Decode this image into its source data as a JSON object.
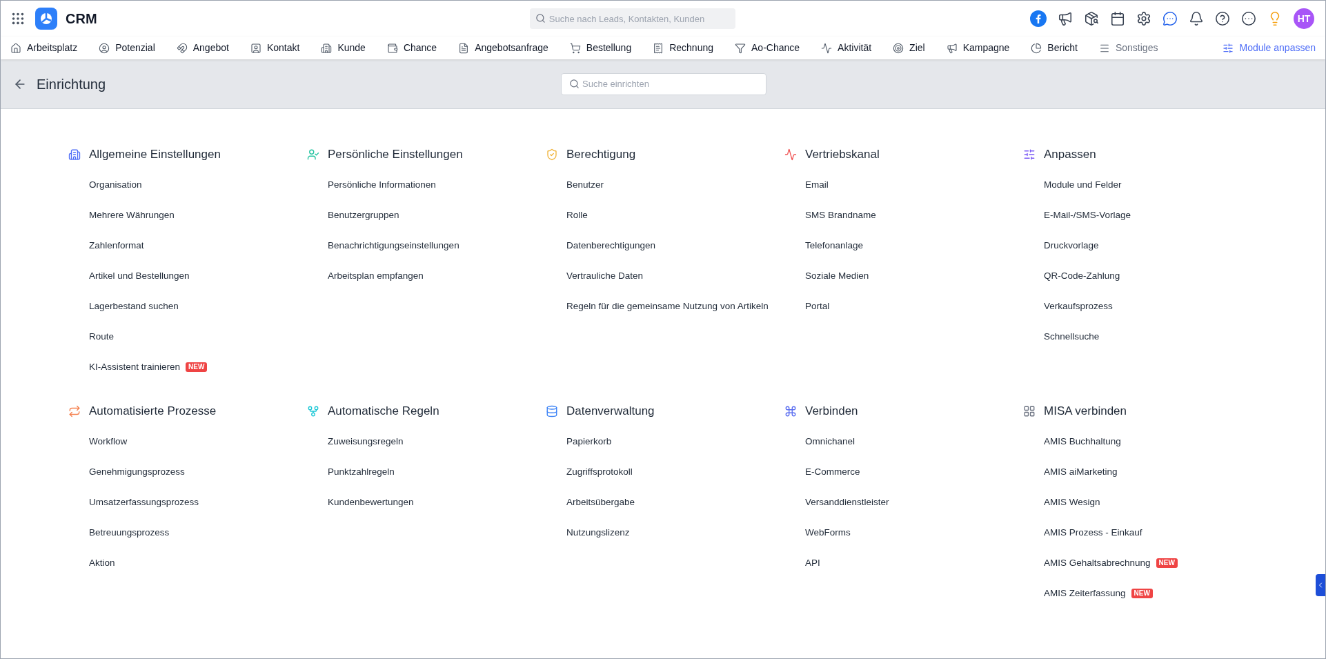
{
  "app": {
    "logo_text": "CRM",
    "search": {
      "placeholder": "Suche nach Leads, Kontakten, Kunden"
    },
    "avatar": "HT"
  },
  "nav": {
    "items": [
      {
        "label": "Arbeitsplatz",
        "kind": "module"
      },
      {
        "label": "Potenzial",
        "kind": "module"
      },
      {
        "label": "Angebot",
        "kind": "module"
      },
      {
        "label": "Kontakt",
        "kind": "module"
      },
      {
        "label": "Kunde",
        "kind": "module"
      },
      {
        "label": "Chance",
        "kind": "module"
      },
      {
        "label": "Angebotsanfrage",
        "kind": "module"
      },
      {
        "label": "Bestellung",
        "kind": "module"
      },
      {
        "label": "Rechnung",
        "kind": "module"
      },
      {
        "label": "Ao-Chance",
        "kind": "module"
      },
      {
        "label": "Aktivität",
        "kind": "module"
      },
      {
        "label": "Ziel",
        "kind": "module"
      },
      {
        "label": "Kampagne",
        "kind": "module"
      },
      {
        "label": "Bericht",
        "kind": "module"
      },
      {
        "label": "Sonstiges",
        "kind": "more"
      }
    ],
    "customize": "Module anpassen"
  },
  "page": {
    "title": "Einrichtung",
    "search": {
      "placeholder": "Suche einrichten"
    }
  },
  "sections": [
    {
      "title": "Allgemeine Einstellungen",
      "color": "#4f6ef7",
      "items": [
        {
          "label": "Organisation"
        },
        {
          "label": "Mehrere Währungen"
        },
        {
          "label": "Zahlenformat"
        },
        {
          "label": "Artikel und Bestellungen"
        },
        {
          "label": "Lagerbestand suchen"
        },
        {
          "label": "Route"
        },
        {
          "label": "KI-Assistent trainieren",
          "badge": "NEW"
        }
      ]
    },
    {
      "title": "Persönliche Einstellungen",
      "color": "#22c3a0",
      "items": [
        {
          "label": "Persönliche Informationen"
        },
        {
          "label": "Benutzergruppen"
        },
        {
          "label": "Benachrichtigungseinstellungen"
        },
        {
          "label": "Arbeitsplan empfangen"
        }
      ]
    },
    {
      "title": "Berechtigung",
      "color": "#f0b43c",
      "items": [
        {
          "label": "Benutzer"
        },
        {
          "label": "Rolle"
        },
        {
          "label": "Datenberechtigungen"
        },
        {
          "label": "Vertrauliche Daten"
        },
        {
          "label": "Regeln für die gemeinsame Nutzung von Artikeln"
        }
      ]
    },
    {
      "title": "Vertriebskanal",
      "color": "#f05252",
      "items": [
        {
          "label": "Email"
        },
        {
          "label": "SMS Brandname"
        },
        {
          "label": "Telefonanlage"
        },
        {
          "label": "Soziale Medien"
        },
        {
          "label": "Portal"
        }
      ]
    },
    {
      "title": "Anpassen",
      "color": "#7c5cf5",
      "items": [
        {
          "label": "Module und Felder"
        },
        {
          "label": "E-Mail-/SMS-Vorlage"
        },
        {
          "label": "Druckvorlage"
        },
        {
          "label": "QR-Code-Zahlung"
        },
        {
          "label": "Verkaufsprozess"
        },
        {
          "label": "Schnellsuche"
        }
      ]
    },
    {
      "title": "Automatisierte Prozesse",
      "color": "#f5814f",
      "items": [
        {
          "label": "Workflow"
        },
        {
          "label": "Genehmigungsprozess"
        },
        {
          "label": "Umsatzerfassungsprozess"
        },
        {
          "label": "Betreuungsprozess"
        },
        {
          "label": "Aktion"
        }
      ]
    },
    {
      "title": "Automatische Regeln",
      "color": "#1ec8d6",
      "items": [
        {
          "label": "Zuweisungsregeln"
        },
        {
          "label": "Punktzahlregeln"
        },
        {
          "label": "Kundenbewertungen"
        }
      ]
    },
    {
      "title": "Datenverwaltung",
      "color": "#3b82f6",
      "items": [
        {
          "label": "Papierkorb"
        },
        {
          "label": "Zugriffsprotokoll"
        },
        {
          "label": "Arbeitsübergabe"
        },
        {
          "label": "Nutzungslizenz"
        }
      ]
    },
    {
      "title": "Verbinden",
      "color": "#5b6ef0",
      "items": [
        {
          "label": "Omnichanel"
        },
        {
          "label": "E-Commerce"
        },
        {
          "label": "Versanddienstleister"
        },
        {
          "label": "WebForms"
        },
        {
          "label": "API"
        }
      ]
    },
    {
      "title": "MISA verbinden",
      "color": "#6b7280",
      "items": [
        {
          "label": "AMIS Buchhaltung"
        },
        {
          "label": "AMIS aiMarketing"
        },
        {
          "label": "AMIS Wesign"
        },
        {
          "label": "AMIS Prozess - Einkauf"
        },
        {
          "label": "AMIS Gehaltsabrechnung",
          "badge": "NEW"
        },
        {
          "label": "AMIS Zeiterfassung",
          "badge": "NEW"
        }
      ]
    }
  ]
}
